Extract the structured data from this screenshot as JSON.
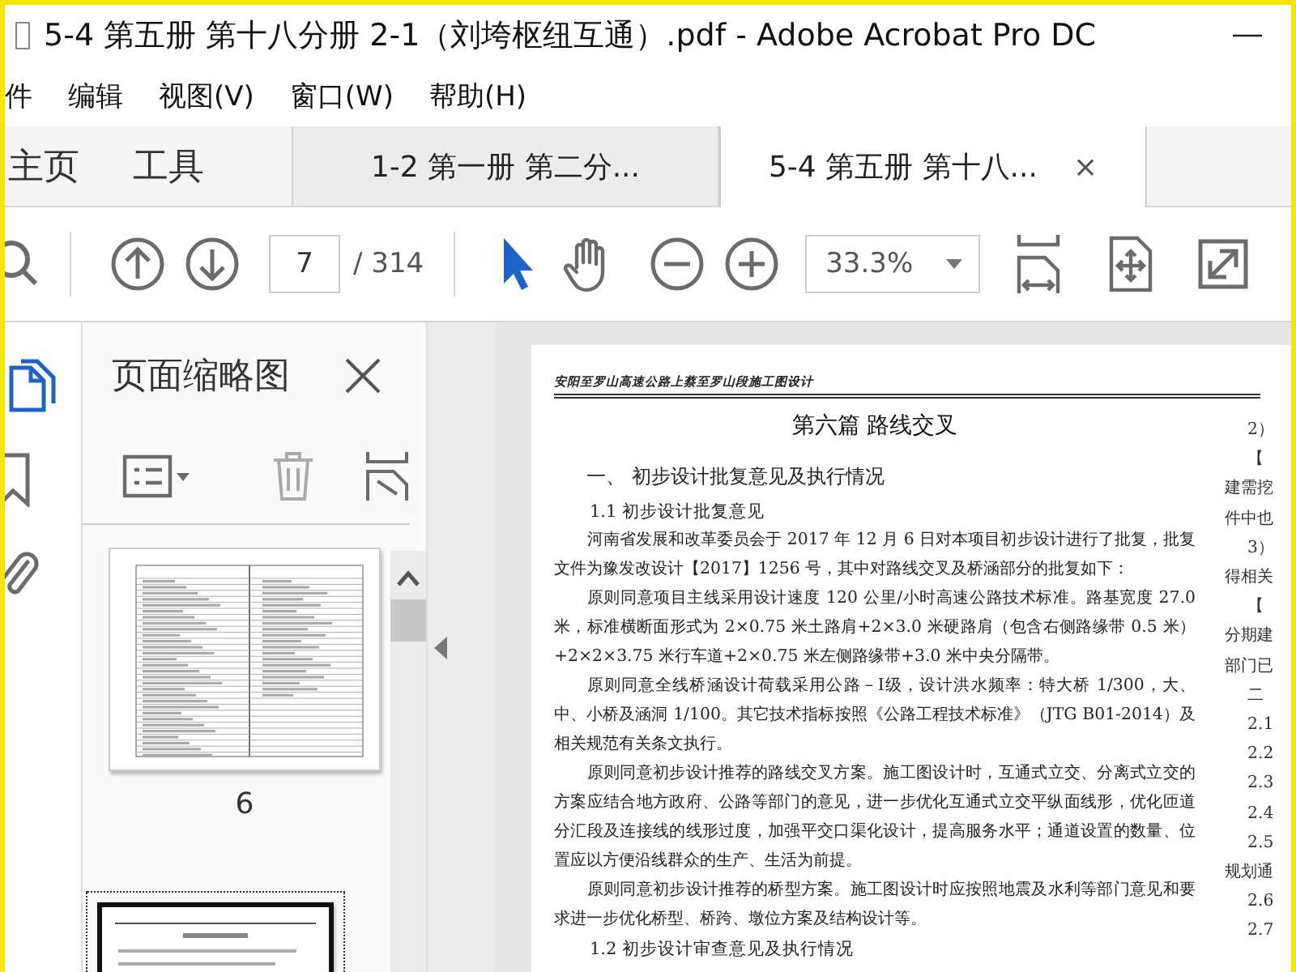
{
  "title_bar": {
    "title": "5-4 第五册 第十八分册 2-1（刘垮枢纽互通）.pdf - Adobe Acrobat Pro DC"
  },
  "menu": [
    "件",
    "编辑",
    "视图(V)",
    "窗口(W)",
    "帮助(H)"
  ],
  "nav_tabs": [
    "主页",
    "工具"
  ],
  "doc_tabs": [
    {
      "label": "1-2 第一册 第二分...",
      "selected": false
    },
    {
      "label": "5-4 第五册 第十八...",
      "selected": true,
      "close": "×"
    }
  ],
  "toolbar": {
    "page": "7",
    "total": "/ 314",
    "zoom": "33.3%",
    "tools": [
      {
        "kind": "select",
        "selected": true
      },
      {
        "kind": "hand",
        "selected": false
      }
    ]
  },
  "sidebar": {
    "rail": [
      {
        "kind": "pages",
        "selected": true
      },
      {
        "kind": "bookmarks",
        "selected": false
      },
      {
        "kind": "attachments",
        "selected": false
      }
    ],
    "panel_title": "页面缩略图",
    "thumbnails": [
      {
        "kind": "table",
        "label": "6",
        "selected": false
      },
      {
        "kind": "text",
        "selected": true
      }
    ]
  },
  "document": {
    "header": "安阳至罗山高速公路上蔡至罗山段施工图设计",
    "title": "第六篇 路线交叉",
    "heading": "一、 初步设计批复意见及执行情况",
    "blocks": [
      {
        "kind": "sub",
        "text": "1.1 初步设计批复意见"
      },
      {
        "kind": "para",
        "text": "河南省发展和改革委员会于 2017 年 12 月 6 日对本项目初步设计进行了批复，批复文件为豫发改设计【2017】1256 号，其中对路线交叉及桥涵部分的批复如下："
      },
      {
        "kind": "para",
        "text": "原则同意项目主线采用设计速度 120 公里/小时高速公路技术标准。路基宽度 27.0 米，标准横断面形式为 2×0.75 米土路肩+2×3.0 米硬路肩（包含右侧路缘带 0.5 米）+2×2×3.75 米行车道+2×0.75 米左侧路缘带+3.0 米中央分隔带。"
      },
      {
        "kind": "para",
        "text": "原则同意全线桥涵设计荷载采用公路－Ⅰ级，设计洪水频率：特大桥 1/300，大、中、小桥及涵洞 1/100。其它技术指标按照《公路工程技术标准》（JTG B01-2014）及相关规范有关条文执行。"
      },
      {
        "kind": "para",
        "text": "原则同意初步设计推荐的路线交叉方案。施工图设计时，互通式立交、分离式立交的方案应结合地方政府、公路等部门的意见，进一步优化互通式立交平纵面线形，优化匝道分汇段及连接线的线形过度，加强平交口渠化设计，提高服务水平；通道设置的数量、位置应以方便沿线群众的生产、生活为前提。"
      },
      {
        "kind": "para",
        "text": "原则同意初步设计推荐的桥型方案。施工图设计时应按照地震及水利等部门意见和要求进一步优化桥型、桥跨、墩位方案及结构设计等。"
      },
      {
        "kind": "sub",
        "text": "1.2 初步设计审查意见及执行情况"
      }
    ],
    "right_column": [
      {
        "kind": "indent",
        "text": "2）"
      },
      {
        "kind": "indent",
        "text": "【"
      },
      {
        "kind": "line",
        "text": "建需挖"
      },
      {
        "kind": "line",
        "text": "件中也"
      },
      {
        "kind": "indent",
        "text": "3）"
      },
      {
        "kind": "line",
        "text": "得相关"
      },
      {
        "kind": "indent",
        "text": "【"
      },
      {
        "kind": "line",
        "text": "分期建"
      },
      {
        "kind": "line",
        "text": "部门已"
      },
      {
        "kind": "indent",
        "text": "二"
      },
      {
        "kind": "indent",
        "text": "2.1"
      },
      {
        "kind": "indent",
        "text": "2.2"
      },
      {
        "kind": "indent",
        "text": "2.3"
      },
      {
        "kind": "indent",
        "text": "2.4"
      },
      {
        "kind": "indent",
        "text": "2.5"
      },
      {
        "kind": "line",
        "text": "规划通"
      },
      {
        "kind": "indent",
        "text": "2.6"
      },
      {
        "kind": "indent",
        "text": "2.7"
      }
    ]
  }
}
